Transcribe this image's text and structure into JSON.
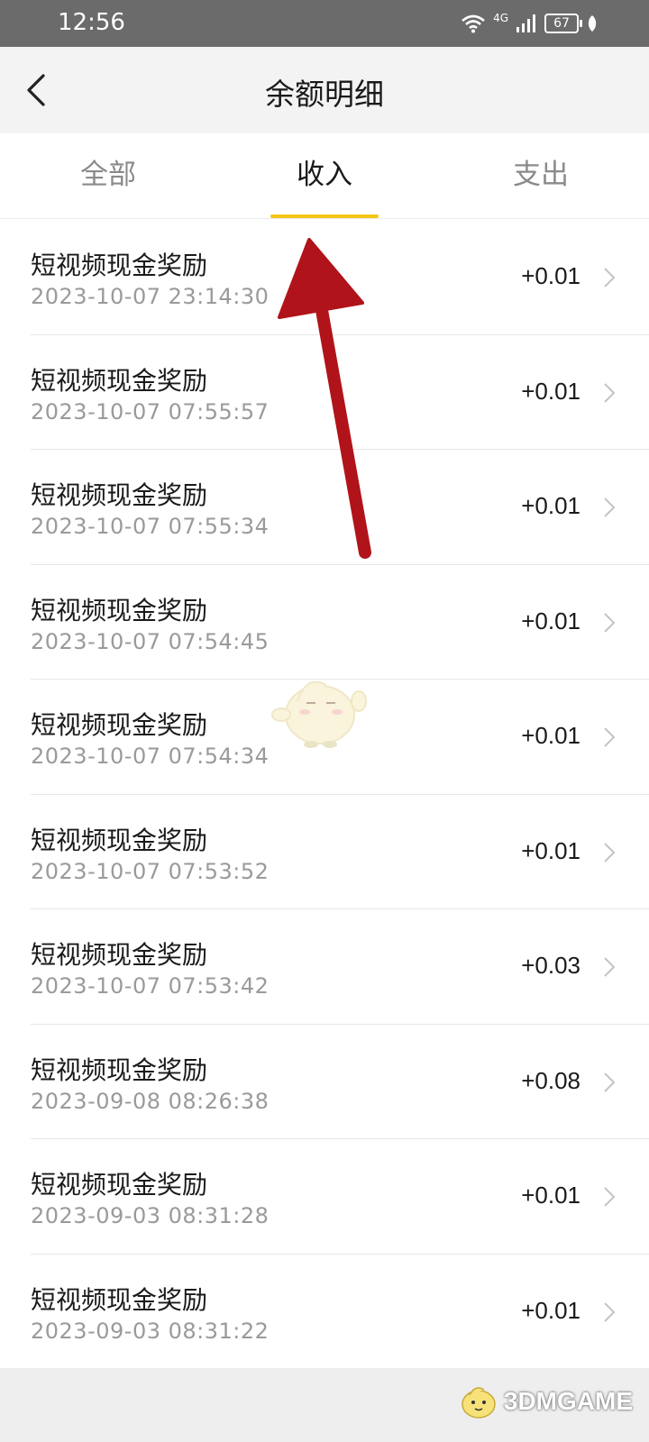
{
  "status_bar": {
    "time": "12:56",
    "network": "4G",
    "battery": "67"
  },
  "header": {
    "title": "余额明细",
    "back_icon": "chevron-left-icon"
  },
  "tabs": [
    {
      "label": "全部",
      "active": false
    },
    {
      "label": "收入",
      "active": true
    },
    {
      "label": "支出",
      "active": false
    }
  ],
  "transactions": [
    {
      "title": "短视频现金奖励",
      "time": "2023-10-07 23:14:30",
      "amount": "+0.01"
    },
    {
      "title": "短视频现金奖励",
      "time": "2023-10-07 07:55:57",
      "amount": "+0.01"
    },
    {
      "title": "短视频现金奖励",
      "time": "2023-10-07 07:55:34",
      "amount": "+0.01"
    },
    {
      "title": "短视频现金奖励",
      "time": "2023-10-07 07:54:45",
      "amount": "+0.01"
    },
    {
      "title": "短视频现金奖励",
      "time": "2023-10-07 07:54:34",
      "amount": "+0.01"
    },
    {
      "title": "短视频现金奖励",
      "time": "2023-10-07 07:53:52",
      "amount": "+0.01"
    },
    {
      "title": "短视频现金奖励",
      "time": "2023-10-07 07:53:42",
      "amount": "+0.03"
    },
    {
      "title": "短视频现金奖励",
      "time": "2023-09-08 08:26:38",
      "amount": "+0.08"
    },
    {
      "title": "短视频现金奖励",
      "time": "2023-09-03 08:31:28",
      "amount": "+0.01"
    },
    {
      "title": "短视频现金奖励",
      "time": "2023-09-03 08:31:22",
      "amount": "+0.01"
    }
  ],
  "watermark": {
    "text": "3DMGAME"
  },
  "colors": {
    "tab_indicator": "#f5c518",
    "annotation_arrow": "#b0141a",
    "status_bar": "#6b6b6b"
  }
}
